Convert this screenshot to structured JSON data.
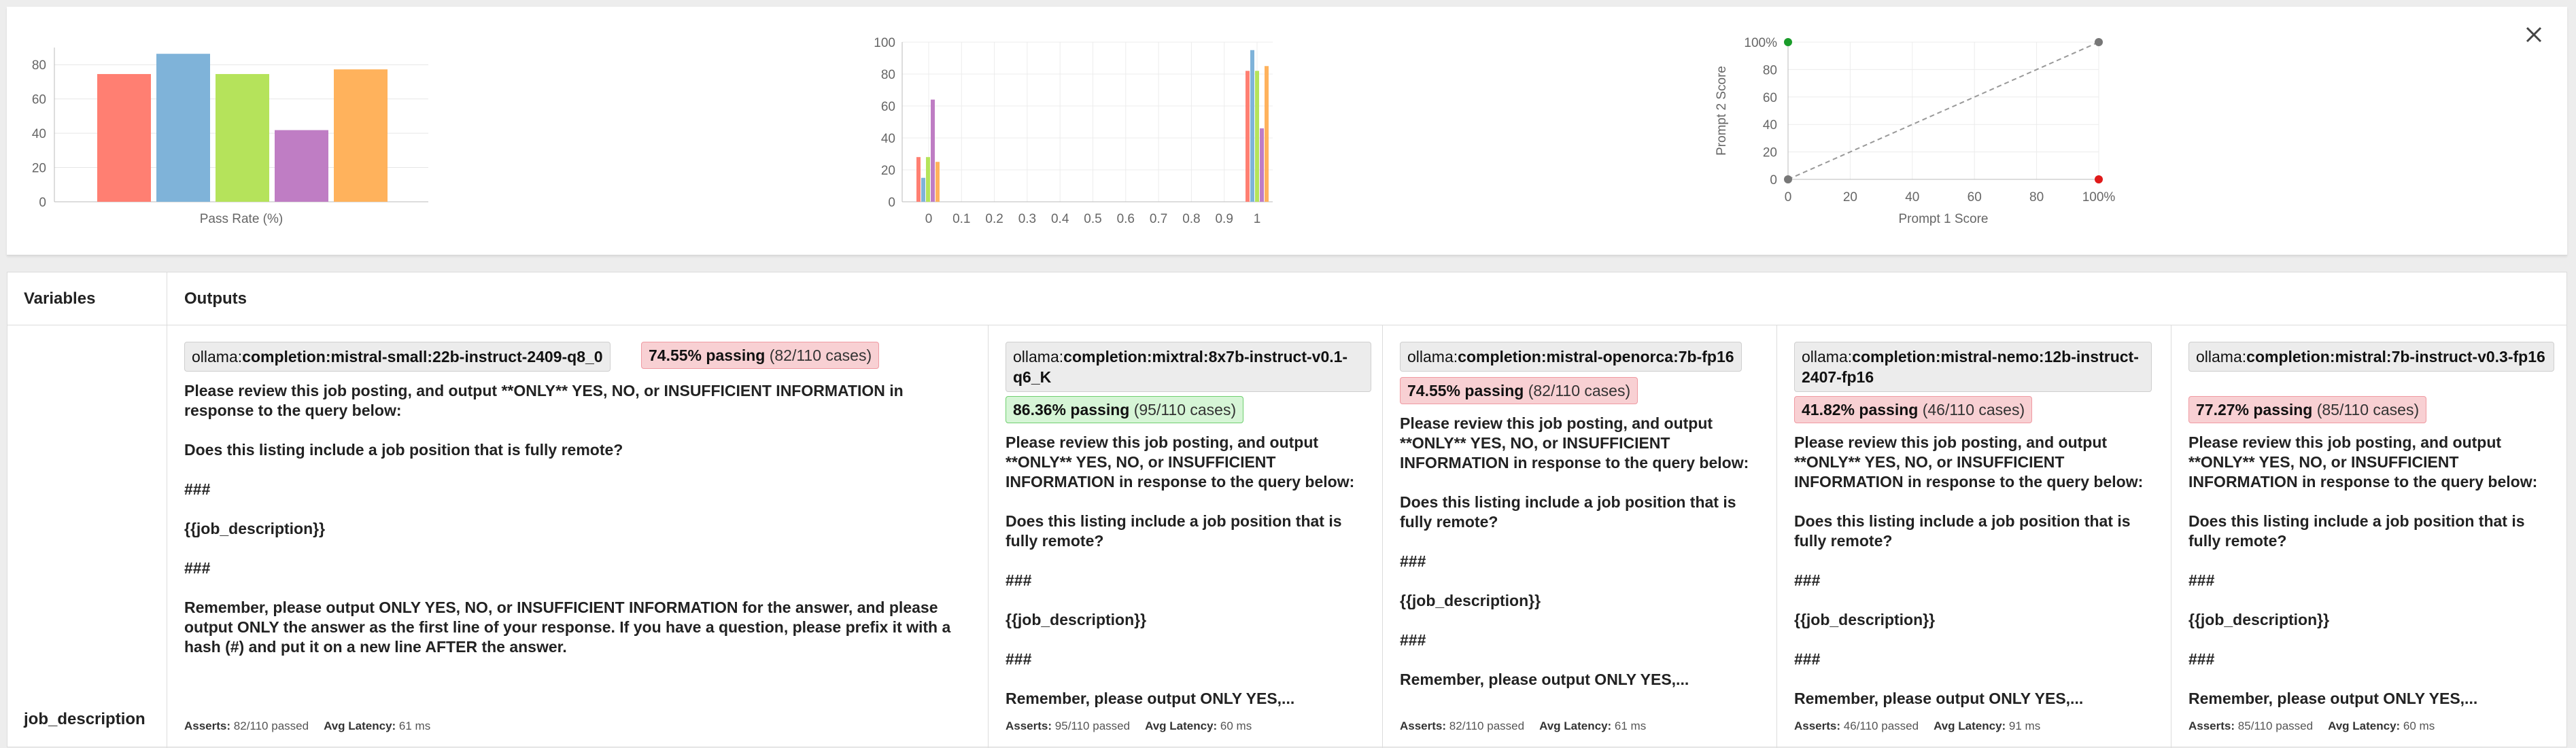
{
  "colors": {
    "series": [
      "#ff7f72",
      "#7fb3d9",
      "#b5e35b",
      "#bf7dc4",
      "#ffb25c"
    ],
    "pass_fail_bg": "#f8d0d3",
    "pass_ok_bg": "#d6f5d6",
    "scatter_green": "#1a9c2a",
    "scatter_red": "#e01a1a"
  },
  "close_icon": "close-icon",
  "chart_data": [
    {
      "type": "bar",
      "xlabel": "Pass Rate (%)",
      "ylabel": "",
      "ylim": [
        0,
        90
      ],
      "yticks": [
        "0",
        "20",
        "40",
        "60",
        "80"
      ],
      "values": [
        74.55,
        86.36,
        74.55,
        41.82,
        77.27
      ],
      "grid": "horizontal"
    },
    {
      "type": "bar",
      "xlabel": "",
      "ylabel": "",
      "ylim": [
        0,
        100
      ],
      "yticks": [
        "0",
        "20",
        "40",
        "60",
        "80",
        "100"
      ],
      "xticks": [
        "0",
        "0.1",
        "0.2",
        "0.3",
        "0.4",
        "0.5",
        "0.6",
        "0.7",
        "0.8",
        "0.9",
        "1"
      ],
      "series": [
        {
          "values_at_0": 28,
          "values_at_1": 82
        },
        {
          "values_at_0": 15,
          "values_at_1": 95
        },
        {
          "values_at_0": 28,
          "values_at_1": 82
        },
        {
          "values_at_0": 64,
          "values_at_1": 46
        },
        {
          "values_at_0": 25,
          "values_at_1": 85
        }
      ],
      "grid": "both"
    },
    {
      "type": "scatter",
      "xlabel": "Prompt 1 Score",
      "ylabel": "Prompt 2 Score",
      "xlim": [
        0,
        1
      ],
      "ylim": [
        0,
        1
      ],
      "xticks": [
        "0",
        "20",
        "40",
        "60",
        "80",
        "100%"
      ],
      "yticks": [
        "0",
        "20",
        "40",
        "60",
        "80",
        "100%"
      ],
      "points": [
        {
          "x": 0,
          "y": 1,
          "color": "green"
        },
        {
          "x": 1,
          "y": 1,
          "color": "gray"
        },
        {
          "x": 0,
          "y": 0,
          "color": "gray"
        },
        {
          "x": 1,
          "y": 0,
          "color": "red"
        }
      ],
      "diagonal": true,
      "grid": "both"
    }
  ],
  "table": {
    "variables_header": "Variables",
    "outputs_header": "Outputs",
    "variable_name": "job_description",
    "asserts_label": "Asserts:",
    "latency_label": "Avg Latency:",
    "columns": [
      {
        "provider_prefix": "ollama:",
        "provider_model": "completion:mistral-small:22b-instruct-2409-q8_0",
        "pass_pct": "74.55% passing",
        "pass_cases": "(82/110 cases)",
        "prompt": "Please review this job posting, and output **ONLY** YES, NO, or INSUFFICIENT INFORMATION in response to the query below:\n\nDoes this listing include a job position that is fully remote?\n\n###\n\n{{job_description}}\n\n###\n\nRemember, please output ONLY YES, NO, or INSUFFICIENT INFORMATION for the answer, and please output ONLY the answer as the first line of your response. If you have a question, please prefix it with a hash (#) and put it on a new line AFTER the answer.",
        "asserts": "82/110 passed",
        "latency": "61 ms"
      },
      {
        "provider_prefix": "ollama:",
        "provider_model": "completion:mixtral:8x7b-instruct-v0.1-q6_K",
        "pass_pct": "86.36% passing",
        "pass_cases": "(95/110 cases)",
        "prompt": "Please review this job posting, and output **ONLY** YES, NO, or INSUFFICIENT INFORMATION in response to the query below:\n\nDoes this listing include a job position that is fully remote?\n\n###\n\n{{job_description}}\n\n###\n\nRemember, please output ONLY YES,...",
        "asserts": "95/110 passed",
        "latency": "60 ms"
      },
      {
        "provider_prefix": "ollama:",
        "provider_model": "completion:mistral-openorca:7b-fp16",
        "pass_pct": "74.55% passing",
        "pass_cases": "(82/110 cases)",
        "prompt": "Please review this job posting, and output **ONLY** YES, NO, or INSUFFICIENT INFORMATION in response to the query below:\n\nDoes this listing include a job position that is fully remote?\n\n###\n\n{{job_description}}\n\n###\n\nRemember, please output ONLY YES,...",
        "asserts": "82/110 passed",
        "latency": "61 ms"
      },
      {
        "provider_prefix": "ollama:",
        "provider_model": "completion:mistral-nemo:12b-instruct-2407-fp16",
        "pass_pct": "41.82% passing",
        "pass_cases": "(46/110 cases)",
        "prompt": "Please review this job posting, and output **ONLY** YES, NO, or INSUFFICIENT INFORMATION in response to the query below:\n\nDoes this listing include a job position that is fully remote?\n\n###\n\n{{job_description}}\n\n###\n\nRemember, please output ONLY YES,...",
        "asserts": "46/110 passed",
        "latency": "91 ms"
      },
      {
        "provider_prefix": "ollama:",
        "provider_model": "completion:mistral:7b-instruct-v0.3-fp16",
        "pass_pct": "77.27% passing",
        "pass_cases": "(85/110 cases)",
        "prompt": "Please review this job posting, and output **ONLY** YES, NO, or INSUFFICIENT INFORMATION in response to the query below:\n\nDoes this listing include a job position that is fully remote?\n\n###\n\n{{job_description}}\n\n###\n\nRemember, please output ONLY YES,...",
        "asserts": "85/110 passed",
        "latency": "60 ms"
      }
    ]
  }
}
